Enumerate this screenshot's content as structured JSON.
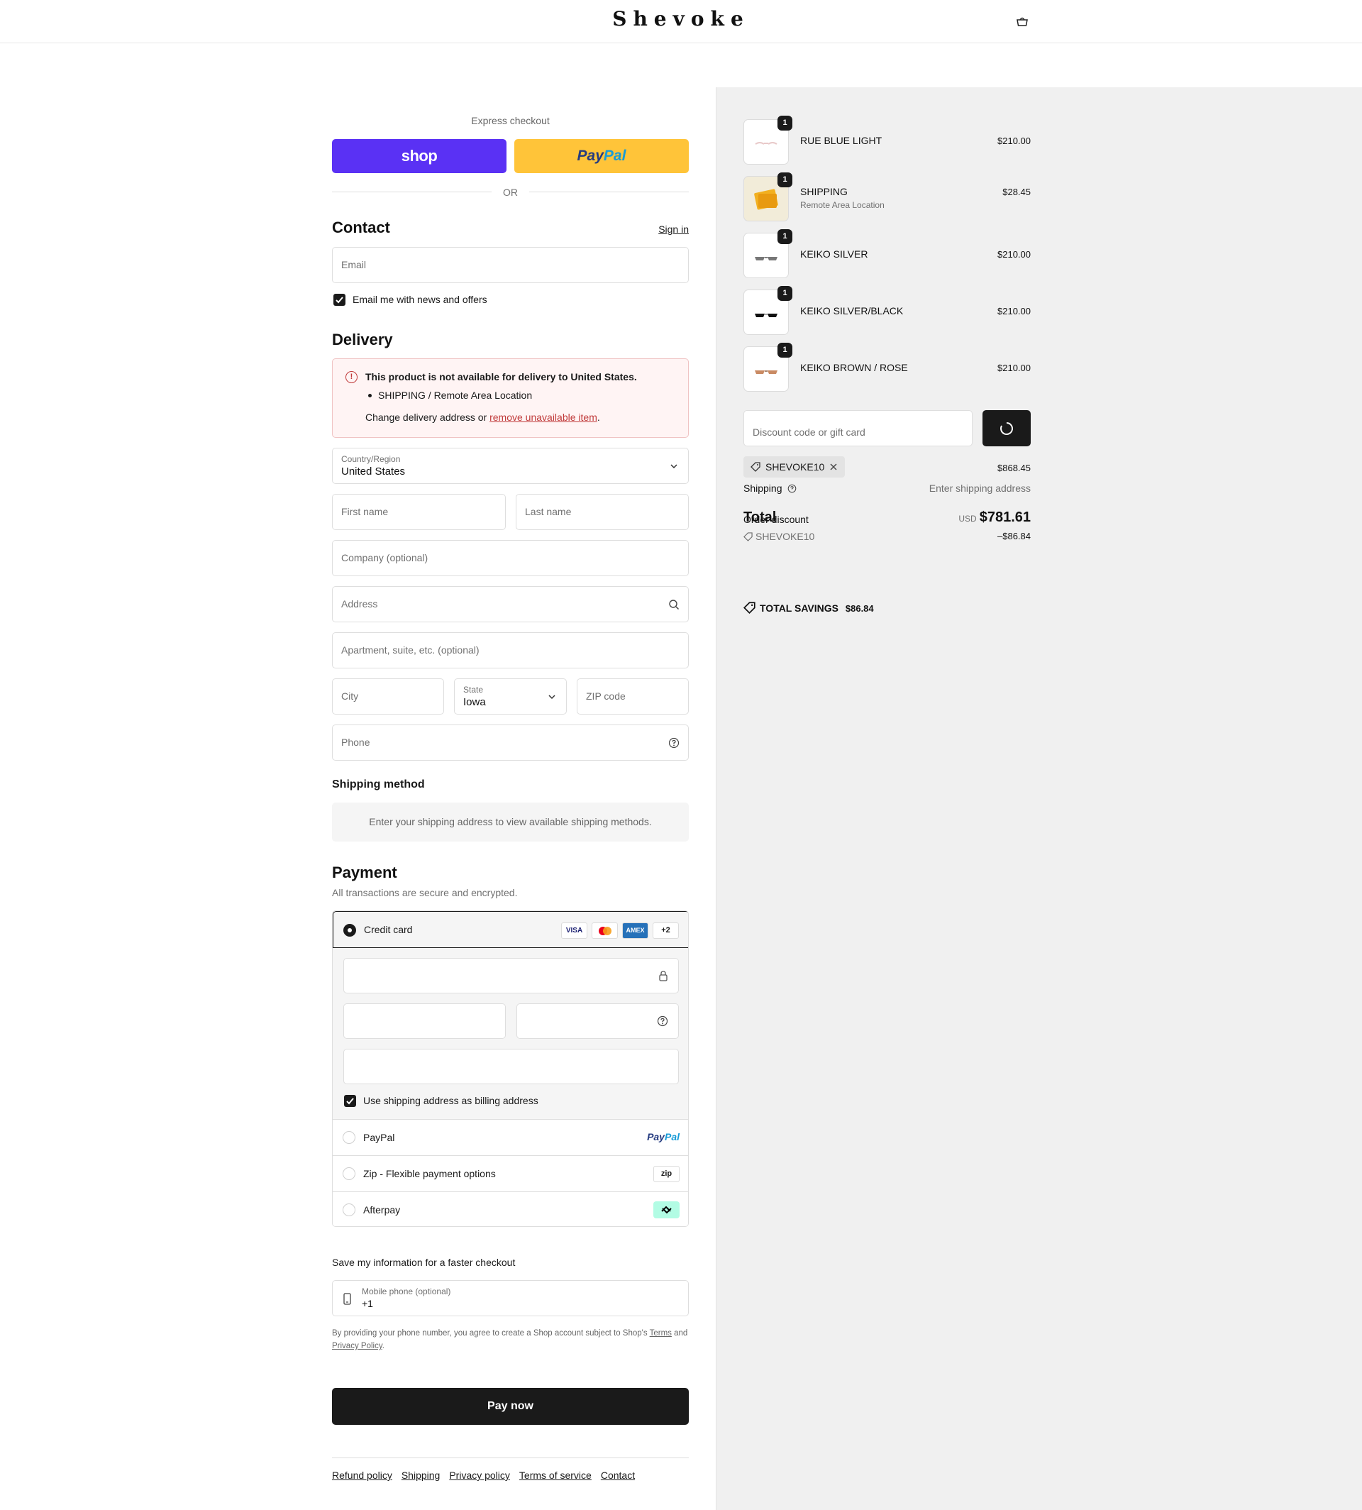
{
  "header": {
    "brand": "Shevoke"
  },
  "express": {
    "label": "Express checkout",
    "shop_label": "shop",
    "paypal_a": "Pay",
    "paypal_b": "Pal",
    "or": "OR"
  },
  "contact": {
    "title": "Contact",
    "sign_in": "Sign in",
    "email_placeholder": "Email",
    "news_label": "Email me with news and offers",
    "news_checked": true
  },
  "delivery": {
    "title": "Delivery",
    "alert_title": "This product is not available for delivery to United States.",
    "alert_item": "SHIPPING / Remote Area Location",
    "alert_change_prefix": "Change delivery address or ",
    "alert_change_link": "remove unavailable item",
    "alert_change_suffix": ".",
    "country_label": "Country/Region",
    "country_value": "United States",
    "first_name": "First name",
    "last_name": "Last name",
    "company": "Company (optional)",
    "address": "Address",
    "apartment": "Apartment, suite, etc. (optional)",
    "city": "City",
    "state_label": "State",
    "state_value": "Iowa",
    "zip": "ZIP code",
    "phone": "Phone"
  },
  "shipping_method": {
    "title": "Shipping method",
    "message": "Enter your shipping address to view available shipping methods."
  },
  "payment": {
    "title": "Payment",
    "subtitle": "All transactions are secure and encrypted.",
    "credit_card": "Credit card",
    "card_badges": [
      "VISA",
      "",
      "AMEX",
      "+2"
    ],
    "billing_label": "Use shipping address as billing address",
    "billing_checked": true,
    "options": [
      "PayPal",
      "Zip - Flexible payment options",
      "Afterpay"
    ],
    "zip_logo": "zip"
  },
  "save_info": {
    "title": "Save my information for a faster checkout",
    "mobile_label": "Mobile phone (optional)",
    "mobile_value": "+1",
    "tos_prefix": "By providing your phone number, you agree to create a Shop account subject to Shop's ",
    "tos_terms": "Terms",
    "tos_and": " and ",
    "tos_privacy": "Privacy Policy",
    "tos_suffix": "."
  },
  "pay_now": "Pay now",
  "footer_links": [
    "Refund policy",
    "Shipping",
    "Privacy policy",
    "Terms of service",
    "Contact"
  ],
  "summary": {
    "items": [
      {
        "name": "RUE BLUE LIGHT",
        "sub": "",
        "price": "$210.00",
        "qty": "1"
      },
      {
        "name": "SHIPPING",
        "sub": "Remote Area Location",
        "price": "$28.45",
        "qty": "1"
      },
      {
        "name": "KEIKO SILVER",
        "sub": "",
        "price": "$210.00",
        "qty": "1"
      },
      {
        "name": "KEIKO SILVER/BLACK",
        "sub": "",
        "price": "$210.00",
        "qty": "1"
      },
      {
        "name": "KEIKO BROWN / ROSE",
        "sub": "",
        "price": "$210.00",
        "qty": "1"
      }
    ],
    "discount_placeholder": "Discount code or gift card",
    "code": "SHEVOKE10",
    "subtotal": "$868.45",
    "shipping_label": "Shipping",
    "shipping_value": "Enter shipping address",
    "total_label": "Total",
    "order_discount_label": "Order discount",
    "currency": "USD",
    "total": "$781.61",
    "discount_code": "SHEVOKE10",
    "discount_amount": "–$86.84",
    "savings_label": "TOTAL SAVINGS",
    "savings_value": "$86.84"
  }
}
